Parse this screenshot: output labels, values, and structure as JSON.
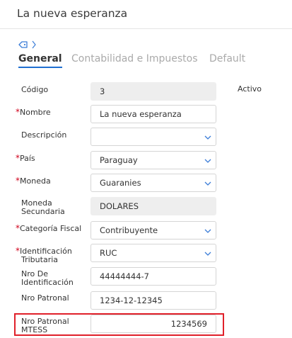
{
  "header": {
    "title": "La nueva esperanza"
  },
  "breadcrumb": {
    "separator": "〉"
  },
  "tabs": [
    {
      "label": "General",
      "active": true
    },
    {
      "label": "Contabilidad e Impuestos",
      "active": false
    },
    {
      "label": "Default",
      "active": false
    }
  ],
  "status": "Activo",
  "form": {
    "codigo": {
      "label": "Código",
      "value": "3"
    },
    "nombre": {
      "label": "Nombre",
      "value": "La nueva esperanza",
      "required": true
    },
    "descripcion": {
      "label": "Descripción",
      "value": ""
    },
    "pais": {
      "label": "País",
      "value": "Paraguay",
      "required": true
    },
    "moneda": {
      "label": "Moneda",
      "value": "Guaranies",
      "required": true
    },
    "moneda_secundaria": {
      "label_line1": "Moneda",
      "label_line2": "Secundaria",
      "value": "DOLARES"
    },
    "categoria_fiscal": {
      "label": "Categoría Fiscal",
      "value": "Contribuyente",
      "required": true
    },
    "identificacion_tributaria": {
      "label_line1": "Identificación",
      "label_line2": "Tributaria",
      "value": "RUC",
      "required": true
    },
    "nro_identificacion": {
      "label_line1": "Nro De",
      "label_line2": "Identificación",
      "value": "44444444-7"
    },
    "nro_patronal": {
      "label": "Nro Patronal",
      "value": "1234-12-12345"
    },
    "nro_patronal_mtess": {
      "label_line1": "Nro Patronal",
      "label_line2": "MTESS",
      "value": "1234569"
    }
  },
  "colors": {
    "accent": "#1f6fd1",
    "required": "#d0021b",
    "highlight": "#e0202a"
  }
}
